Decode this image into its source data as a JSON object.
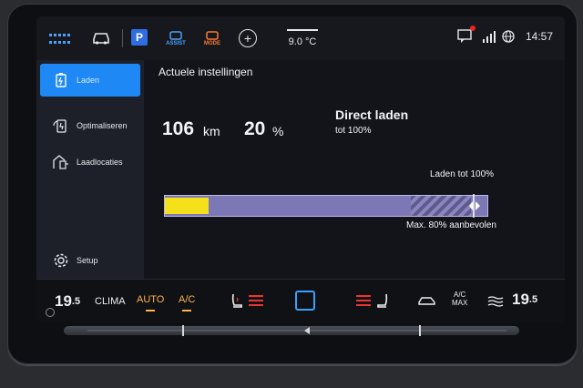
{
  "status": {
    "outside_temp": "9.0 °C",
    "clock": "14:57",
    "parking_label": "P",
    "assist_label": "ASSIST",
    "mode_label": "MODE"
  },
  "sidebar": {
    "items": [
      {
        "label": "Laden",
        "icon": "battery-charge-icon",
        "active": true
      },
      {
        "label": "Optimaliseren",
        "icon": "optimize-charge-icon",
        "active": false
      },
      {
        "label": "Laadlocaties",
        "icon": "charging-location-icon",
        "active": false
      },
      {
        "label": "Setup",
        "icon": "gear-icon",
        "active": false
      }
    ]
  },
  "main": {
    "title": "Actuele instellingen",
    "range_value": "106",
    "range_unit": "km",
    "soc_value": "20",
    "soc_unit": "%",
    "mode_title": "Direct laden",
    "mode_subtitle": "tot 100%",
    "target_label": "Laden tot 100%",
    "recommend_label": "Max. 80% aanbevolen",
    "charge_level": 0.2,
    "target_level": 1.0,
    "recommended_level": 0.8
  },
  "climate": {
    "left_temp": "19",
    "left_temp_decimal": ".5",
    "clima_label": "CLIMA",
    "auto_label": "AUTO",
    "ac_label": "A/C",
    "ac_max_top": "A/C",
    "ac_max_bottom": "MAX",
    "right_temp": "19",
    "right_temp_decimal": ".5"
  },
  "colors": {
    "accent": "#1e88f5",
    "charge_fill": "#f4e11a",
    "bar_body": "#7c77b5",
    "active_orange": "#ffb24a",
    "seat_heat_red": "#e33333"
  }
}
